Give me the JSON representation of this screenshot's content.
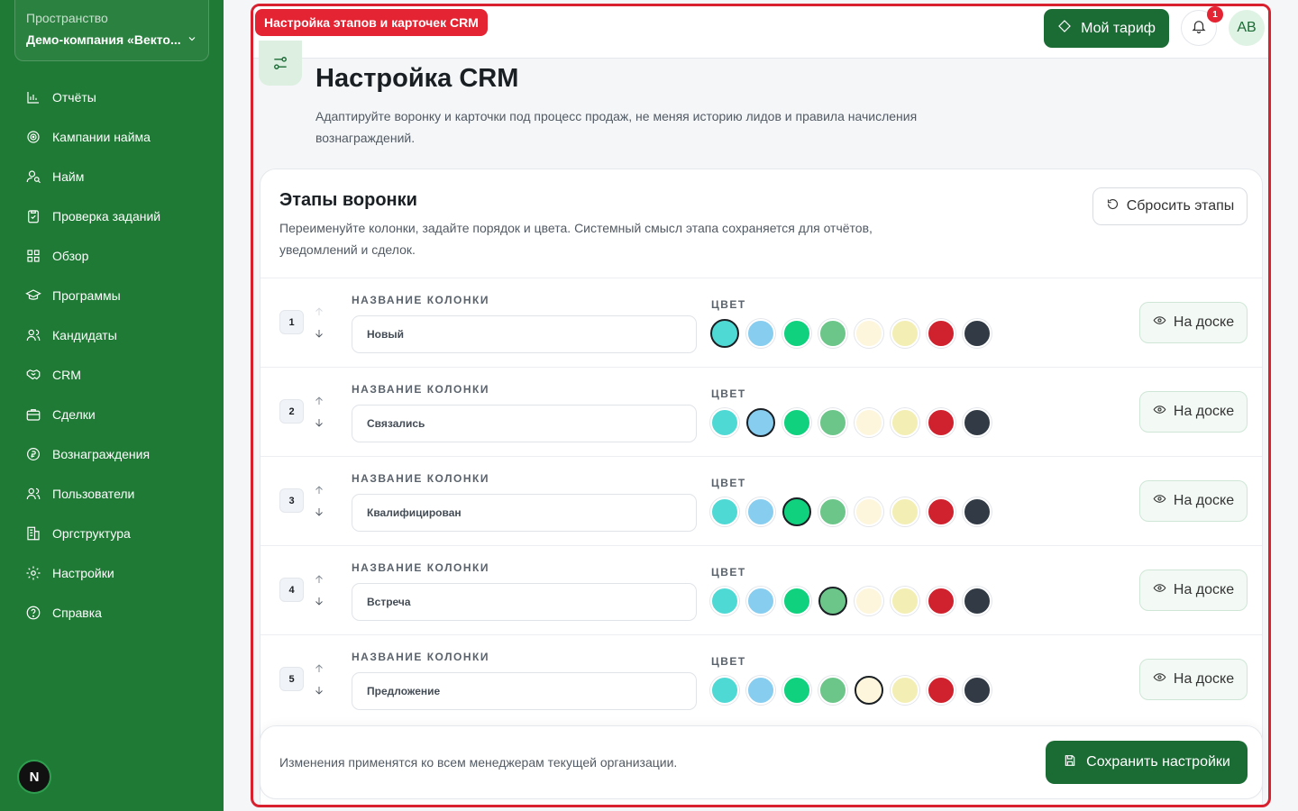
{
  "workspace": {
    "label": "Пространство",
    "name": "Демо-компания «Векто..."
  },
  "nav": [
    {
      "label": "Отчёты",
      "icon": "chart-icon"
    },
    {
      "label": "Кампании найма",
      "icon": "target-icon"
    },
    {
      "label": "Найм",
      "icon": "user-search-icon"
    },
    {
      "label": "Проверка заданий",
      "icon": "clipboard-check-icon"
    },
    {
      "label": "Обзор",
      "icon": "grid-icon"
    },
    {
      "label": "Программы",
      "icon": "graduation-cap-icon"
    },
    {
      "label": "Кандидаты",
      "icon": "users-icon"
    },
    {
      "label": "CRM",
      "icon": "handshake-icon"
    },
    {
      "label": "Сделки",
      "icon": "briefcase-icon"
    },
    {
      "label": "Вознаграждения",
      "icon": "coin-icon"
    },
    {
      "label": "Пользователи",
      "icon": "users-icon"
    },
    {
      "label": "Оргструктура",
      "icon": "building-icon"
    },
    {
      "label": "Настройки",
      "icon": "gear-icon"
    },
    {
      "label": "Справка",
      "icon": "help-icon"
    }
  ],
  "bottom_badge": "N",
  "header": {
    "tag": "Настройка этапов и карточек CRM",
    "tariff": "Мой тариф",
    "notifications": "1",
    "avatar": "AB"
  },
  "page": {
    "title": "Настройка CRM",
    "description": "Адаптируйте воронку и карточки под процесс продаж, не меняя историю лидов и правила начисления вознаграждений."
  },
  "card": {
    "title": "Этапы воронки",
    "description": "Переименуйте колонки, задайте порядок и цвета. Системный смысл этапа сохраняется для отчётов, уведомлений и сделок.",
    "reset": "Сбросить этапы",
    "column_label": "НАЗВАНИЕ КОЛОНКИ",
    "color_label": "ЦВЕТ",
    "board_label": "На доске"
  },
  "palette": [
    "#4fd9d4",
    "#87cdf0",
    "#10d17e",
    "#6cc68a",
    "#fdf6dc",
    "#f3efb4",
    "#d0222e",
    "#323b45"
  ],
  "stages": [
    {
      "num": "1",
      "name": "Новый",
      "selected": 0
    },
    {
      "num": "2",
      "name": "Связались",
      "selected": 1
    },
    {
      "num": "3",
      "name": "Квалифицирован",
      "selected": 2
    },
    {
      "num": "4",
      "name": "Встреча",
      "selected": 3
    },
    {
      "num": "5",
      "name": "Предложение",
      "selected": 4
    }
  ],
  "footer": {
    "text": "Изменения применятся ко всем менеджерам текущей организации.",
    "save": "Сохранить настройки"
  }
}
